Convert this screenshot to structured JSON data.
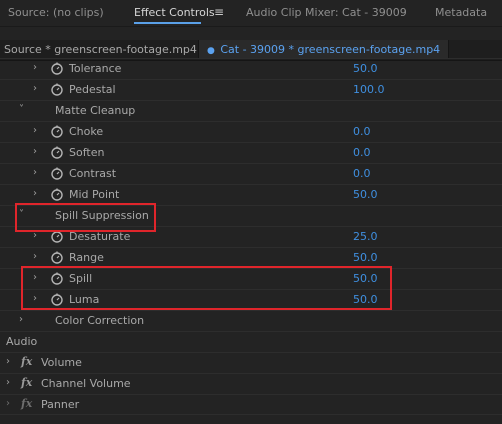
{
  "tabs": [
    {
      "label": "Source: (no clips)"
    },
    {
      "label": "Effect Controls"
    },
    {
      "label": "Audio Clip Mixer: Cat - 39009"
    },
    {
      "label": "Metadata"
    }
  ],
  "menu_icon": "≡",
  "subtabs": {
    "source": "Source * greenscreen-footage.mp4",
    "clip": "Cat - 39009 * greenscreen-footage.mp4"
  },
  "params": {
    "tolerance": {
      "label": "Tolerance",
      "value": "50.0"
    },
    "pedestal": {
      "label": "Pedestal",
      "value": "100.0"
    },
    "matte_cleanup": {
      "label": "Matte Cleanup"
    },
    "choke": {
      "label": "Choke",
      "value": "0.0"
    },
    "soften": {
      "label": "Soften",
      "value": "0.0"
    },
    "contrast": {
      "label": "Contrast",
      "value": "0.0"
    },
    "mid_point": {
      "label": "Mid Point",
      "value": "50.0"
    },
    "spill_suppression": {
      "label": "Spill Suppression"
    },
    "desaturate": {
      "label": "Desaturate",
      "value": "25.0"
    },
    "range": {
      "label": "Range",
      "value": "50.0"
    },
    "spill": {
      "label": "Spill",
      "value": "50.0"
    },
    "luma": {
      "label": "Luma",
      "value": "50.0"
    },
    "color_correction": {
      "label": "Color Correction"
    }
  },
  "audio": {
    "header": "Audio",
    "fx_symbol": "fx",
    "effects": [
      {
        "label": "Volume"
      },
      {
        "label": "Channel Volume"
      },
      {
        "label": "Panner"
      }
    ]
  },
  "colors": {
    "accent_blue": "#3f8fe0",
    "highlight_red": "#e0252b"
  }
}
